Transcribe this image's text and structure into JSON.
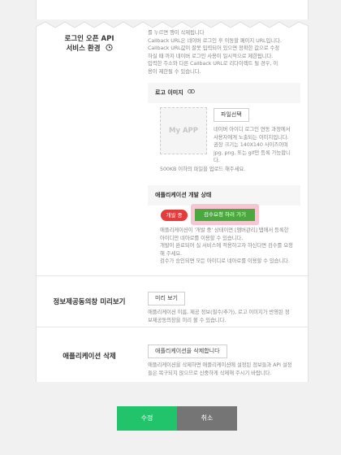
{
  "login_api": {
    "label_line1": "로그인 오픈 API",
    "label_line2": "서비스 환경",
    "help_icon": "clock-icon",
    "desc": [
      "를 누르면 행이 삭제됩니다",
      "Callback URL은 네이버 로그인 후 이동할 페이지 URL입니다.",
      "Callback URL값이 잘못 입력되어 있으면 정확한 값으로 수정",
      "하실 때 까지 네이버 로그인 사용이 일시적으로 제한됩니다.",
      "입력한 주소와 다른 Callback URL로 리다이렉트 될 경우, 이",
      "용이 제한될 수 있습니다."
    ]
  },
  "logo": {
    "title": "로고 이미지",
    "link_icon": "link-icon",
    "upload_label": "파일선택",
    "placeholder": "My APP",
    "desc": [
      "네이버 아이디 로그인 연동 과정에서",
      "사용자에게 노출되는 이미지입니다.",
      "권장 크기는 140X140 사이즈이며",
      "jpg, png, 또는 gif만 등록 가능합니",
      "다."
    ],
    "size_limit": "500KB 이하의 파일을 업로드 해주세요."
  },
  "status": {
    "title": "애플리케이션 개발 상태",
    "badge": "개발 중",
    "review_button": "검수요청 하러 가기",
    "desc": [
      "애플리케이션이 '개발 중' 상태이면 [멤버관리] 탭에서 등록한",
      "아이디만 네아로를 이용할 수 있습니다.",
      "개발이 완료되어 실 서비스에 적용하고자 하신다면 검수를 요청",
      "해 주세요.",
      "검수가 승인되면 모든 아이디로 네아로를 이용할 수 있습니다."
    ]
  },
  "preview": {
    "label": "정보제공동의창 미리보기",
    "button": "미리 보기",
    "desc": [
      "애플리케이션 이름, 제공 정보(필수/추가), 로고 이미지가 반영된 정",
      "보제공동의창을 미리 볼 수 있습니다."
    ]
  },
  "delete": {
    "label": "애플리케이션 삭제",
    "button": "애플리케이션을 삭제합니다",
    "desc": [
      "애플리케이션을 삭제하면 애플리케이션에 설정된 정보들과 API 설정",
      "들은 복구되지 않으므로 신중하게 삭제해 주시기 바랍니다."
    ]
  },
  "footer": {
    "save_label": "수정",
    "cancel_label": "취소"
  },
  "colors": {
    "save": "#21c36b",
    "cancel": "#757575",
    "badge": "#e23c3c",
    "review": "#4aa83e",
    "review_highlight": "#f7c6d3"
  }
}
